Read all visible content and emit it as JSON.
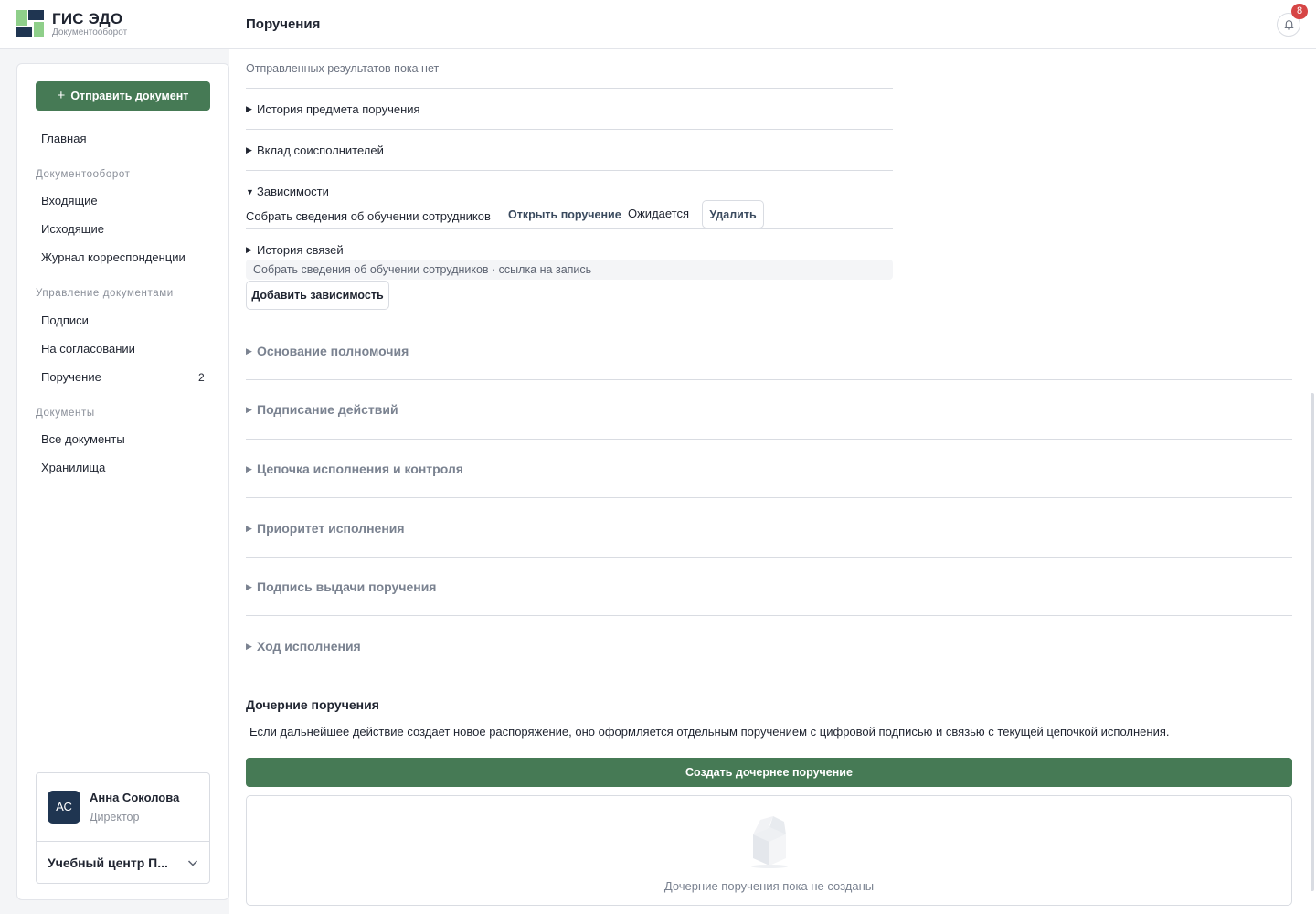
{
  "header": {
    "brand_title": "ГИС ЭДО",
    "brand_subtitle": "Документооборот",
    "page_title": "Поручения",
    "notifications_count": "8"
  },
  "sidebar": {
    "send_button": "Отправить документ",
    "home": "Главная",
    "sections": [
      {
        "title": "Документооборот",
        "items": [
          "Входящие",
          "Исходящие",
          "Журнал корреспонденции"
        ]
      },
      {
        "title": "Управление документами",
        "items": [
          "Подписи",
          "На согласовании",
          "Поручение"
        ]
      },
      {
        "title": "Документы",
        "items": [
          "Все документы",
          "Хранилища"
        ]
      }
    ],
    "assignment_count": "2",
    "user": {
      "initials": "АС",
      "name": "Анна Соколова",
      "role": "Директор",
      "org": "Учебный центр П..."
    }
  },
  "main": {
    "results_empty": "Отправленных результатов пока нет",
    "history_subject": "История предмета поручения",
    "co_executors": "Вклад соисполнителей",
    "dependencies": {
      "title": "Зависимости",
      "item_title": "Собрать сведения об обучении сотрудников",
      "open_link": "Открыть поручение",
      "status": "Ожидается",
      "delete_button": "Удалить",
      "link_history_title": "История связей",
      "link_history_entry": "Собрать сведения об обучении сотрудников · ссылка на запись",
      "add_button": "Добавить зависимость"
    },
    "sections": [
      "Основание полномочия",
      "Подписание действий",
      "Цепочка исполнения и контроля",
      "Приоритет исполнения",
      "Подпись выдачи поручения",
      "Ход исполнения"
    ],
    "child": {
      "title": "Дочерние поручения",
      "description": "Если дальнейшее действие создает новое распоряжение, оно оформляется отдельным поручением с цифровой подписью и связью с текущей цепочкой исполнения.",
      "create_button": "Создать дочернее поручение",
      "empty_text": "Дочерние поручения пока не созданы"
    }
  },
  "colors": {
    "accent": "#467a55",
    "navy": "#1f3551",
    "logo_green": "#8fcf8a",
    "badge": "#d64545"
  }
}
